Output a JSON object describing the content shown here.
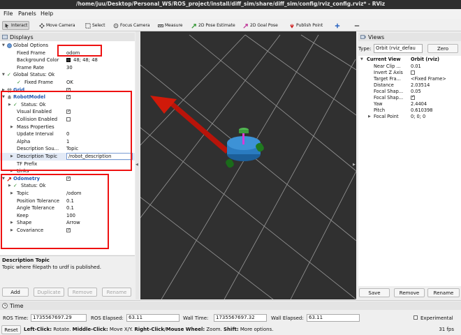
{
  "window": {
    "title": "/home/juu/Desktop/Personal_WS/ROS_project/install/diff_sim/share/diff_sim/config/rviz_config.rviz* - RViz"
  },
  "menu": [
    "File",
    "Panels",
    "Help"
  ],
  "toolbar": {
    "tools": [
      "Interact",
      "Move Camera",
      "Select",
      "Focus Camera",
      "Measure",
      "2D Pose Estimate",
      "2D Goal Pose",
      "Publish Point"
    ],
    "active": "Interact"
  },
  "displays": {
    "header": "Displays",
    "rows": [
      {
        "label": "Global Options",
        "value": ""
      },
      {
        "label": "Fixed Frame",
        "value": "odom"
      },
      {
        "label": "Background Color",
        "value": "48; 48; 48"
      },
      {
        "label": "Frame Rate",
        "value": "30"
      },
      {
        "label": "Global Status: Ok",
        "value": ""
      },
      {
        "label": "Fixed Frame",
        "value": "OK"
      },
      {
        "label": "Grid",
        "value": ""
      },
      {
        "label": "RobotModel",
        "value": ""
      },
      {
        "label": "Status: Ok",
        "value": ""
      },
      {
        "label": "Visual Enabled",
        "value": ""
      },
      {
        "label": "Collision Enabled",
        "value": ""
      },
      {
        "label": "Mass Properties",
        "value": ""
      },
      {
        "label": "Update Interval",
        "value": "0"
      },
      {
        "label": "Alpha",
        "value": "1"
      },
      {
        "label": "Description Sou...",
        "value": "Topic"
      },
      {
        "label": "Description Topic",
        "value": "/robot_description"
      },
      {
        "label": "TF Prefix",
        "value": ""
      },
      {
        "label": "Links",
        "value": ""
      },
      {
        "label": "Odometry",
        "value": ""
      },
      {
        "label": "Status: Ok",
        "value": ""
      },
      {
        "label": "Topic",
        "value": "/odom"
      },
      {
        "label": "Position Tolerance",
        "value": "0.1"
      },
      {
        "label": "Angle Tolerance",
        "value": "0.1"
      },
      {
        "label": "Keep",
        "value": "100"
      },
      {
        "label": "Shape",
        "value": "Arrow"
      },
      {
        "label": "Covariance",
        "value": ""
      }
    ],
    "background_swatch": "#303030",
    "description_heading": "Description Topic",
    "description_text": "Topic where filepath to urdf is published.",
    "buttons": [
      "Add",
      "Duplicate",
      "Remove",
      "Rename"
    ]
  },
  "views": {
    "header": "Views",
    "type_label": "Type:",
    "type_value": "Orbit (rviz_defau",
    "zero_button": "Zero",
    "columns": [
      "Current View",
      "Orbit (rviz)"
    ],
    "rows": [
      {
        "label": "Near Clip ...",
        "value": "0.01"
      },
      {
        "label": "Invert Z Axis",
        "value": ""
      },
      {
        "label": "Target Fra...",
        "value": "<Fixed Frame>"
      },
      {
        "label": "Distance",
        "value": "2.03514"
      },
      {
        "label": "Focal Shap...",
        "value": "0.05"
      },
      {
        "label": "Focal Shap...",
        "value": ""
      },
      {
        "label": "Yaw",
        "value": "2.4404"
      },
      {
        "label": "Pitch",
        "value": "0.610398"
      },
      {
        "label": "Focal Point",
        "value": "0; 0; 0"
      }
    ],
    "buttons": [
      "Save",
      "Remove",
      "Rename"
    ]
  },
  "time": {
    "header": "Time",
    "ros_time_label": "ROS Time:",
    "ros_time": "1735567697.29",
    "ros_elapsed_label": "ROS Elapsed:",
    "ros_elapsed": "63.11",
    "wall_time_label": "Wall Time:",
    "wall_time": "1735567697.32",
    "wall_elapsed_label": "Wall Elapsed:",
    "wall_elapsed": "63.11",
    "experimental_label": "Experimental"
  },
  "status": {
    "reset": "Reset",
    "hint_parts": [
      "Left-Click:",
      " Rotate. ",
      "Middle-Click:",
      " Move X/Y. ",
      "Right-Click/Mouse Wheel:",
      " Zoom. ",
      "Shift:",
      " More options."
    ],
    "fps": "31 fps"
  },
  "colors": {
    "viewport_bg": "#303030",
    "grid": "#a0a0a0",
    "robot_body": "#2a7bc0",
    "wheels": "#1f7a1f",
    "odometry_arrow": "#d01a0a",
    "highlight_box": "#ee1111",
    "accent_blue": "#1e56b0"
  }
}
